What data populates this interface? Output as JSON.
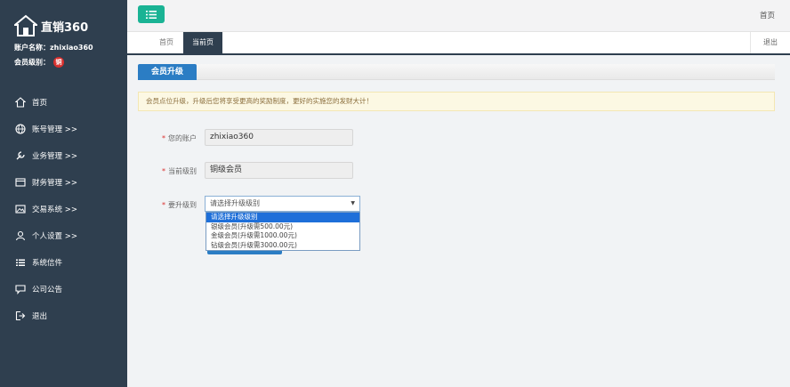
{
  "sidebar": {
    "logo_text": "直销360",
    "account_label": "账户名称：",
    "account_value": "zhixiao360",
    "level_label": "会员级别：",
    "level_badge": "铜",
    "items": [
      {
        "label": "首页",
        "icon": "home-icon"
      },
      {
        "label": "账号管理 >>",
        "icon": "globe-icon"
      },
      {
        "label": "业务管理 >>",
        "icon": "wrench-icon"
      },
      {
        "label": "财务管理 >>",
        "icon": "wallet-icon"
      },
      {
        "label": "交易系统 >>",
        "icon": "image-icon"
      },
      {
        "label": "个人设置 >>",
        "icon": "user-icon"
      },
      {
        "label": "系统信件",
        "icon": "list-icon"
      },
      {
        "label": "公司公告",
        "icon": "chat-icon"
      },
      {
        "label": "退出",
        "icon": "logout-icon"
      }
    ]
  },
  "topbar": {
    "home_link": "首页"
  },
  "tabs": {
    "home": "首页",
    "current": "当前页",
    "logout": "退出"
  },
  "section": {
    "title": "会员升级"
  },
  "notice": "会员点位升级，升级后您将享受更高的奖励制度，更好的实施您的发财大计！",
  "form": {
    "account_label": "您的账户",
    "account_value": "zhixiao360",
    "current_level_label": "当前级别",
    "current_level_value": "铜级会员",
    "upgrade_label": "要升级到",
    "select_value": "请选择升级级别",
    "options": [
      "请选择升级级别",
      "银级会员(升级需500.00元)",
      "金级会员(升级需1000.00元)",
      "钻级会员(升级需3000.00元)"
    ]
  },
  "colors": {
    "sidebar": "#2f3f4f",
    "menu_button": "#1ab394",
    "accent_blue": "#2b7dc4",
    "badge_red": "#d9302e"
  }
}
